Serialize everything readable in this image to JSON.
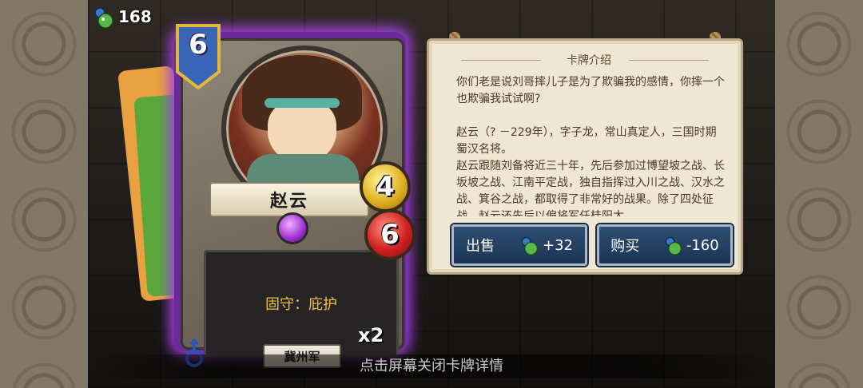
{
  "currency": {
    "icon": "gourd-coin-icon",
    "amount": "168"
  },
  "card": {
    "cost": "6",
    "name": "赵云",
    "attack": "4",
    "health": "6",
    "ability": "固守：庇护",
    "faction": "冀州军",
    "count": "x2",
    "rarity_color": "#a040e0"
  },
  "info": {
    "title": "卡牌介绍",
    "body": "你们老是说刘哥摔儿子是为了欺骗我的感情，你摔一个也欺骗我试试啊?\n\n赵云（? －229年），字子龙，常山真定人，三国时期蜀汉名将。\n赵云跟随刘备将近三十年，先后参加过博望坡之战、长坂坡之战、江南平定战，独自指挥过入川之战、汉水之战、箕谷之战，都取得了非常好的战果。除了四处征战，赵云还先后以偏将军任桂阳太",
    "sell_label": "出售",
    "sell_price": "+32",
    "buy_label": "购买",
    "buy_price": "-160"
  },
  "hint": "点击屏幕关闭卡牌详情"
}
